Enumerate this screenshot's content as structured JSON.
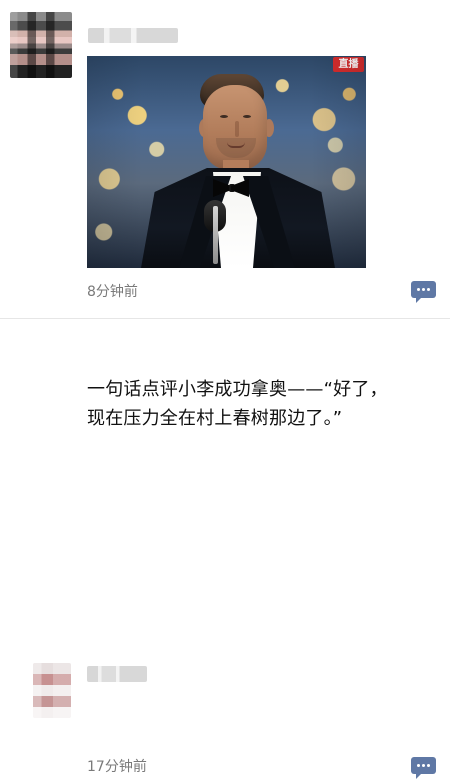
{
  "feed": {
    "posts": [
      {
        "image": {
          "badge_text": "直播"
        },
        "timestamp": "8分钟前",
        "comment_icon": "comment-icon"
      },
      {
        "text": "一句话点评小李成功拿奥——“好了，\n现在压力全在村上春树那边了。”",
        "timestamp": "17分钟前",
        "comment_icon": "comment-icon"
      }
    ],
    "colors": {
      "background": "#ffffff",
      "text_primary": "#111111",
      "text_secondary": "#7a7a7a",
      "divider": "#e6e6e6",
      "action_button": "#5f78a5",
      "badge": "#d62c2c"
    }
  }
}
